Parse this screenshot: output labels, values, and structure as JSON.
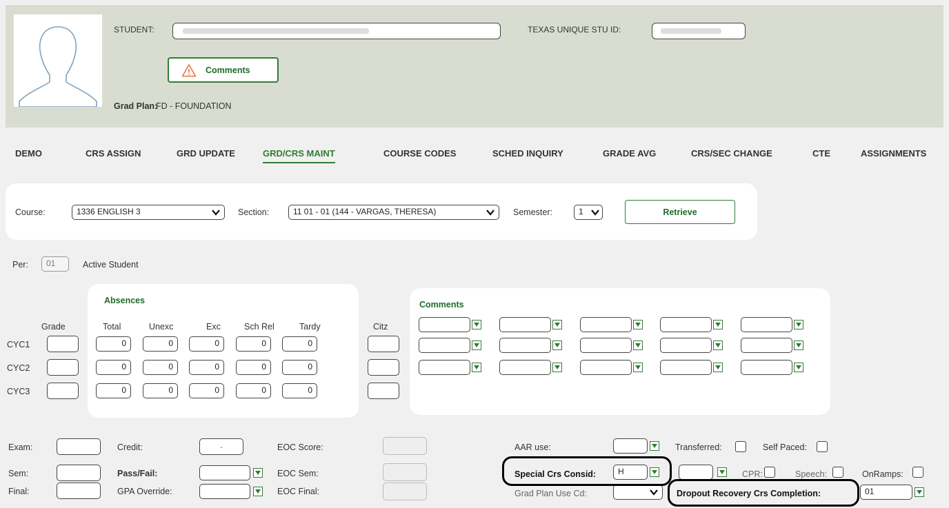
{
  "header": {
    "student_label": "STUDENT:",
    "student_value": "",
    "texas_id_label": "TEXAS UNIQUE STU ID:",
    "texas_id_value": "",
    "comments_button": "Comments",
    "grad_plan_label": "Grad Plan:",
    "grad_plan_value": "FD - FOUNDATION"
  },
  "tabs": [
    {
      "label": "DEMO"
    },
    {
      "label": "CRS ASSIGN"
    },
    {
      "label": "GRD UPDATE"
    },
    {
      "label": "GRD/CRS MAINT"
    },
    {
      "label": "COURSE CODES"
    },
    {
      "label": "SCHED INQUIRY"
    },
    {
      "label": "GRADE AVG"
    },
    {
      "label": "CRS/SEC CHANGE"
    },
    {
      "label": "CTE"
    },
    {
      "label": "ASSIGNMENTS"
    }
  ],
  "filter": {
    "course_label": "Course:",
    "course_value": "1336 ENGLISH 3",
    "section_label": "Section:",
    "section_value": "11 01 - 01 (144 - VARGAS, THERESA)",
    "semester_label": "Semester:",
    "semester_value": "1",
    "retrieve_button": "Retrieve"
  },
  "student_status": {
    "per_label": "Per:",
    "per_value": "01",
    "status_text": "Active Student"
  },
  "grid": {
    "grade_header": "Grade",
    "absences_title": "Absences",
    "absence_headers": [
      "Total",
      "Unexc",
      "Exc",
      "Sch Rel",
      "Tardy"
    ],
    "citz_header": "Citz",
    "comments_title": "Comments",
    "rows": [
      {
        "label": "CYC1",
        "absences": [
          "0",
          "0",
          "0",
          "0",
          "0"
        ]
      },
      {
        "label": "CYC2",
        "absences": [
          "0",
          "0",
          "0",
          "0",
          "0"
        ]
      },
      {
        "label": "CYC3",
        "absences": [
          "0",
          "0",
          "0",
          "0",
          "0"
        ]
      }
    ]
  },
  "bottom": {
    "exam_label": "Exam:",
    "sem_label": "Sem:",
    "final_label": "Final:",
    "credit_label": "Credit:",
    "credit_value": ".",
    "pass_fail_label": "Pass/Fail:",
    "gpa_override_label": "GPA Override:",
    "eoc_score_label": "EOC Score:",
    "eoc_sem_label": "EOC Sem:",
    "eoc_final_label": "EOC Final:",
    "aar_use_label": "AAR use:",
    "special_crs_label": "Special Crs Consid:",
    "special_crs_value": "H",
    "grad_plan_use_label": "Grad Plan Use Cd:",
    "transferred_label": "Transferred:",
    "self_paced_label": "Self Paced:",
    "cpr_label": "CPR:",
    "speech_label": "Speech:",
    "onramps_label": "OnRamps:",
    "dropout_label": "Dropout Recovery Crs Completion:",
    "dropout_value": "01"
  }
}
